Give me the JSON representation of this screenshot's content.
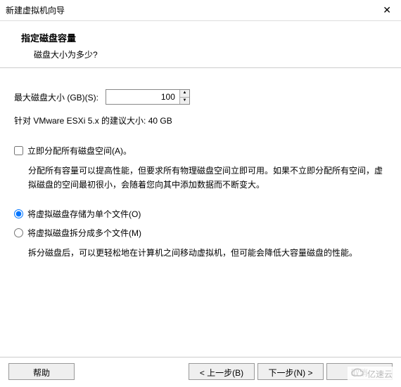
{
  "titlebar": {
    "title": "新建虚拟机向导",
    "close": "✕"
  },
  "header": {
    "title": "指定磁盘容量",
    "subtitle": "磁盘大小为多少?"
  },
  "size": {
    "label": "最大磁盘大小 (GB)(S):",
    "value": "100",
    "recommended": "针对 VMware ESXi 5.x 的建议大小: 40 GB"
  },
  "allocate": {
    "label": "立即分配所有磁盘空间(A)。",
    "checked": false,
    "desc": "分配所有容量可以提高性能，但要求所有物理磁盘空间立即可用。如果不立即分配所有空间，虚拟磁盘的空间最初很小，会随着您向其中添加数据而不断变大。"
  },
  "store": {
    "single": "将虚拟磁盘存储为单个文件(O)",
    "split": "将虚拟磁盘拆分成多个文件(M)",
    "selected": "single",
    "splitDesc": "拆分磁盘后，可以更轻松地在计算机之间移动虚拟机，但可能会降低大容量磁盘的性能。"
  },
  "buttons": {
    "help": "帮助",
    "back": "< 上一步(B)",
    "next": "下一步(N) >",
    "cancel": "取消"
  },
  "watermark": {
    "text": "亿速云"
  }
}
